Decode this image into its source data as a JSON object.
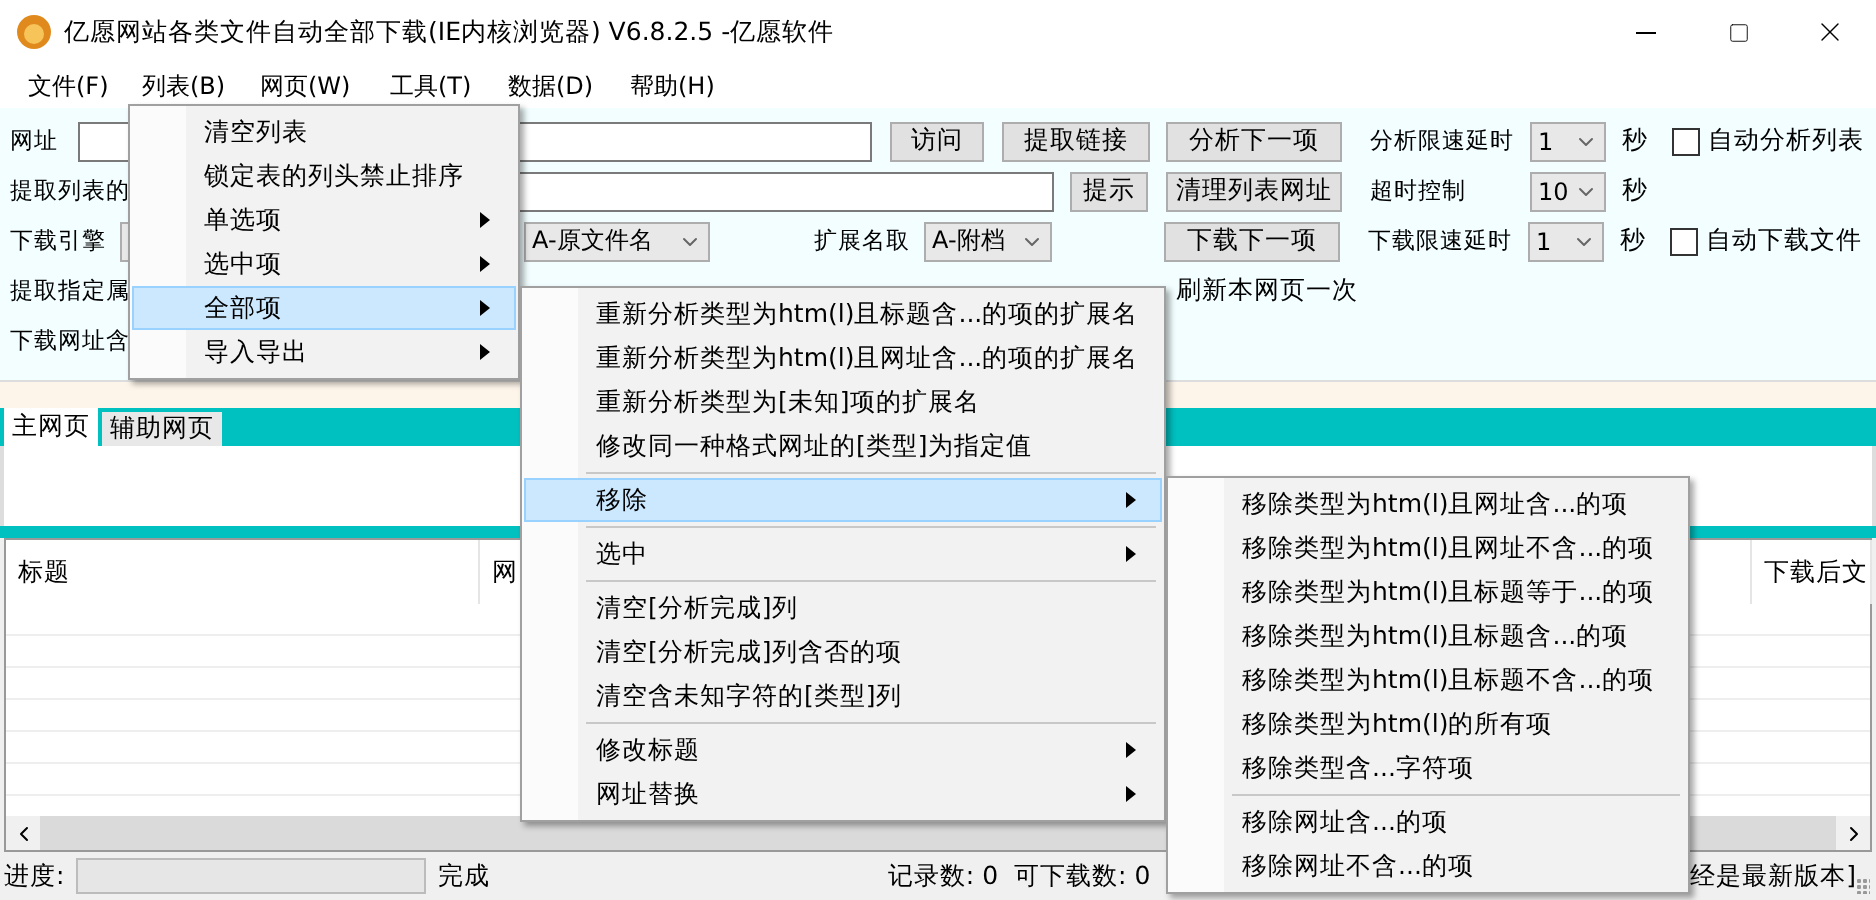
{
  "window": {
    "title": "亿愿网站各类文件自动全部下载(IE内核浏览器) V6.8.2.5 -亿愿软件"
  },
  "menu_bar": [
    "文件(F)",
    "列表(B)",
    "网页(W)",
    "工具(T)",
    "数据(D)",
    "帮助(H)"
  ],
  "form": {
    "row_1": {
      "label": "网址",
      "buttons": [
        "访问",
        "提取链接",
        "分析下一项"
      ],
      "delay_label": "分析限速延时",
      "delay_value": "1",
      "unit": "秒",
      "checkbox": {
        "label": "自动分析列表",
        "checked": false
      }
    },
    "row_2": {
      "label": "提取列表的",
      "buttons": [
        "提示",
        "清理列表网址"
      ],
      "timeout_label": "超时控制",
      "timeout_value": "10",
      "unit": "秒"
    },
    "row_3": {
      "label": "下载引擎",
      "filename_value": "A-原文件名",
      "ext_label": "扩展名取",
      "ext_value": "A-附档",
      "button": "下载下一项",
      "delay_label": "下载限速延时",
      "delay_value": "1",
      "unit": "秒",
      "checkbox": {
        "label": "自动下载文件",
        "checked": false
      }
    },
    "row_4": {
      "label": "提取指定属",
      "refresh_text": "刷新本网页一次"
    },
    "row_5": {
      "label": "下载网址含"
    }
  },
  "tabs": [
    {
      "label": "主网页",
      "selected": true
    },
    {
      "label": "辅助网页",
      "selected": false
    }
  ],
  "table": {
    "columns": [
      "标题",
      "网",
      "下载后文"
    ]
  },
  "status_bar": {
    "progress_label": "进度:",
    "progress": {
      "level": 0
    },
    "state": "完成",
    "records": "记录数: 0",
    "downloadable": "可下载数: 0",
    "version_note": "经是最新版本]"
  },
  "menus": [
    {
      "items": [
        {
          "kind": "item",
          "label": "清空列表",
          "has_submenu": false,
          "selected": false
        },
        {
          "kind": "item",
          "label": "锁定表的列头禁止排序",
          "has_submenu": false,
          "selected": false
        },
        {
          "kind": "item",
          "label": "单选项",
          "has_submenu": true,
          "selected": false
        },
        {
          "kind": "item",
          "label": "选中项",
          "has_submenu": true,
          "selected": false
        },
        {
          "kind": "item",
          "label": "全部项",
          "has_submenu": true,
          "selected": true
        },
        {
          "kind": "item",
          "label": "导入导出",
          "has_submenu": true,
          "selected": false
        }
      ]
    },
    {
      "items": [
        {
          "kind": "item",
          "label": "重新分析类型为htm(l)且标题含...的项的扩展名",
          "has_submenu": false,
          "selected": false
        },
        {
          "kind": "item",
          "label": "重新分析类型为htm(l)且网址含...的项的扩展名",
          "has_submenu": false,
          "selected": false
        },
        {
          "kind": "item",
          "label": "重新分析类型为[未知]项的扩展名",
          "has_submenu": false,
          "selected": false
        },
        {
          "kind": "item",
          "label": "修改同一种格式网址的[类型]为指定值",
          "has_submenu": false,
          "selected": false
        },
        {
          "kind": "separator"
        },
        {
          "kind": "item",
          "label": "移除",
          "has_submenu": true,
          "selected": true
        },
        {
          "kind": "separator"
        },
        {
          "kind": "item",
          "label": "选中",
          "has_submenu": true,
          "selected": false
        },
        {
          "kind": "separator"
        },
        {
          "kind": "item",
          "label": "清空[分析完成]列",
          "has_submenu": false,
          "selected": false
        },
        {
          "kind": "item",
          "label": "清空[分析完成]列含否的项",
          "has_submenu": false,
          "selected": false
        },
        {
          "kind": "item",
          "label": "清空含未知字符的[类型]列",
          "has_submenu": false,
          "selected": false
        },
        {
          "kind": "separator"
        },
        {
          "kind": "item",
          "label": "修改标题",
          "has_submenu": true,
          "selected": false
        },
        {
          "kind": "item",
          "label": "网址替换",
          "has_submenu": true,
          "selected": false
        }
      ]
    },
    {
      "items": [
        {
          "kind": "item",
          "label": "移除类型为htm(l)且网址含...的项",
          "has_submenu": false,
          "selected": false
        },
        {
          "kind": "item",
          "label": "移除类型为htm(l)且网址不含...的项",
          "has_submenu": false,
          "selected": false
        },
        {
          "kind": "item",
          "label": "移除类型为htm(l)且标题等于...的项",
          "has_submenu": false,
          "selected": false
        },
        {
          "kind": "item",
          "label": "移除类型为htm(l)且标题含...的项",
          "has_submenu": false,
          "selected": false
        },
        {
          "kind": "item",
          "label": "移除类型为htm(l)且标题不含...的项",
          "has_submenu": false,
          "selected": false
        },
        {
          "kind": "item",
          "label": "移除类型为htm(l)的所有项",
          "has_submenu": false,
          "selected": false
        },
        {
          "kind": "item",
          "label": "移除类型含...字符项",
          "has_submenu": false,
          "selected": false
        },
        {
          "kind": "separator"
        },
        {
          "kind": "item",
          "label": "移除网址含...的项",
          "has_submenu": false,
          "selected": false
        },
        {
          "kind": "item",
          "label": "移除网址不含...的项",
          "has_submenu": false,
          "selected": false
        }
      ]
    }
  ]
}
